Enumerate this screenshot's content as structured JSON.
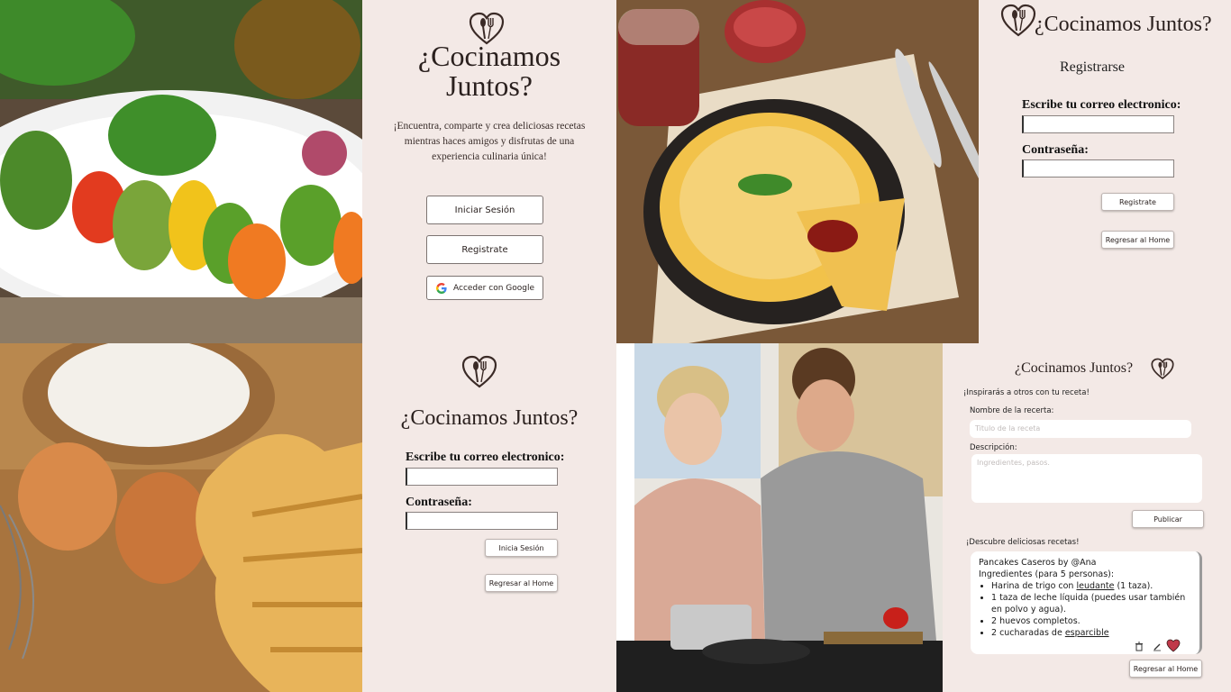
{
  "brand": {
    "name_line1": "¿Cocinamos",
    "name_line2": "Juntos?",
    "name": "¿Cocinamos Juntos?"
  },
  "home": {
    "tagline": "¡Encuentra, comparte y crea deliciosas recetas mientras haces amigos y disfrutas de una experiencia culinaria única!",
    "login_label": "Iniciar Sesión",
    "register_label": "Registrate",
    "google_label": "Acceder con Google"
  },
  "register": {
    "title": "Registrarse",
    "email_label": "Escribe tu correo electronico:",
    "password_label": "Contraseña:",
    "submit_label": "Registrate",
    "back_label": "Regresar al Home"
  },
  "login": {
    "email_label": "Escribe tu correo electronico:",
    "password_label": "Contraseña:",
    "submit_label": "Inicia Sesión",
    "back_label": "Regresar al Home"
  },
  "recipes": {
    "inspire_heading": "¡Inspirarás a otros con tu receta!",
    "name_label": "Nombre de la recerta:",
    "name_placeholder": "Titulo de la receta",
    "desc_label": "Descripción:",
    "desc_placeholder": "Ingredientes, pasos.",
    "publish_label": "Publicar",
    "discover_heading": "¡Descubre deliciosas recetas!",
    "card": {
      "title": "Pancakes Caseros by @Ana",
      "subtitle": "Ingredientes (para 5 personas):",
      "item1_pre": "Harina de trigo con ",
      "item1_link": "leudante",
      "item1_post": " (1 taza).",
      "item2": "1 taza de leche líquida (puedes usar también en polvo y agua).",
      "item3": "2 huevos completos.",
      "item4_pre": "2 cucharadas de ",
      "item4_link": "esparcible "
    },
    "back_label": "Regresar al Home"
  },
  "icons": {
    "logo": "heart-spoon-fork-logo-icon",
    "google": "google-icon",
    "trash": "trash-icon",
    "edit": "pencil-icon",
    "like": "heart-icon"
  },
  "colors": {
    "panel": "#f3e9e6",
    "ink": "#3a2a26",
    "heart": "#c0394a"
  }
}
